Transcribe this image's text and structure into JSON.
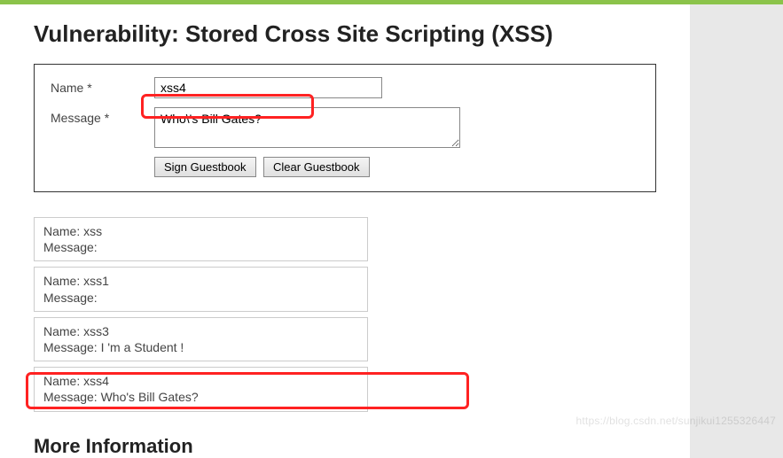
{
  "header": {
    "title": "Vulnerability: Stored Cross Site Scripting (XSS)"
  },
  "form": {
    "name_label": "Name *",
    "name_value": "xss4",
    "message_label": "Message *",
    "message_value": "Who\\'s Bill Gates?",
    "sign_button": "Sign Guestbook",
    "clear_button": "Clear Guestbook"
  },
  "entries": [
    {
      "name_label": "Name:",
      "name": "xss",
      "message_label": "Message:",
      "message": ""
    },
    {
      "name_label": "Name:",
      "name": "xss1",
      "message_label": "Message:",
      "message": ""
    },
    {
      "name_label": "Name:",
      "name": "xss3",
      "message_label": "Message:",
      "message": "I 'm a Student !"
    },
    {
      "name_label": "Name:",
      "name": "xss4",
      "message_label": "Message:",
      "message": "Who's Bill Gates?"
    }
  ],
  "more_info_heading": "More Information",
  "watermark": "https://blog.csdn.net/sunjikui1255326447"
}
